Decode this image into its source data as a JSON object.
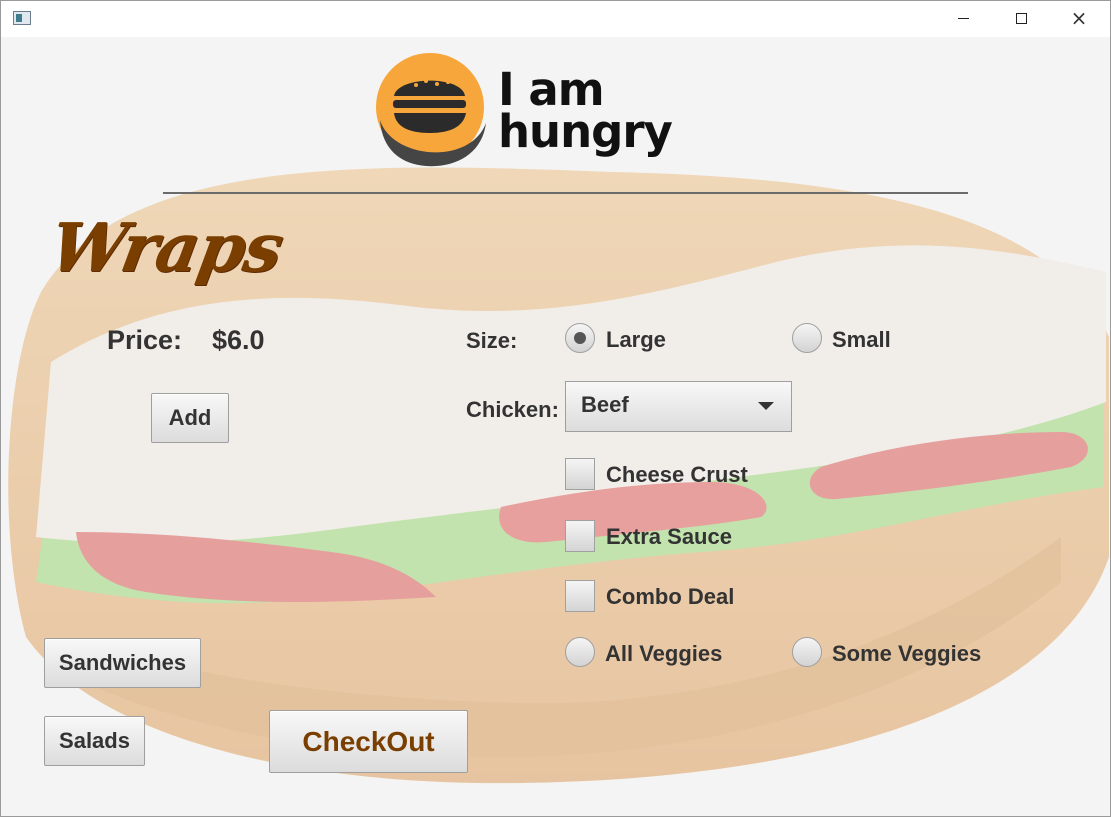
{
  "app": {
    "title": "",
    "logo_line1": "I am",
    "logo_line2": "hungry",
    "section_title": "Wraps"
  },
  "order": {
    "price_label": "Price:",
    "price_value": "$6.0",
    "size_label": "Size:",
    "size_options": [
      "Large",
      "Small"
    ],
    "selected_size": "Large",
    "chicken_label": "Chicken:",
    "chicken_selected": "Beef",
    "extras": [
      "Cheese Crust",
      "Extra Sauce",
      "Combo Deal"
    ],
    "veggie_options": [
      "All Veggies",
      "Some Veggies"
    ]
  },
  "buttons": {
    "add": "Add",
    "sandwiches": "Sandwiches",
    "salads": "Salads",
    "checkout": "CheckOut"
  },
  "colors": {
    "accent": "#7a3f00",
    "logo_orange": "#f7a63b",
    "background": "#f4f4f4"
  },
  "icons": {
    "logo": "burger-icon",
    "dropdown": "chevron-down-icon"
  }
}
